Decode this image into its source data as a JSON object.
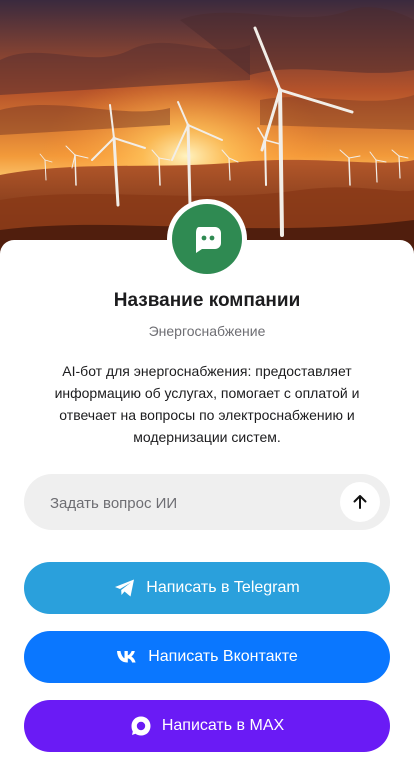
{
  "hero": {
    "image_name": "wind-turbines-sunset"
  },
  "company": {
    "name": "Название компании",
    "category": "Энергоснабжение",
    "description": "AI-бот для энергоснабжения: предоставляет информацию об услугах, помогает с оплатой и отвечает на вопросы по электроснабжению и модернизации систем.",
    "avatar_icon": "chat-bot-icon",
    "avatar_color": "#2f8a52"
  },
  "ask": {
    "placeholder": "Задать вопрос ИИ",
    "value": "",
    "send_icon": "arrow-up-icon"
  },
  "actions": [
    {
      "label": "Написать в Telegram",
      "icon": "telegram-icon",
      "color": "#2aa0dc"
    },
    {
      "label": "Написать Вконтакте",
      "icon": "vk-icon",
      "color": "#0a77ff"
    },
    {
      "label": "Написать в MAX",
      "icon": "max-icon",
      "color": "#6a1bf5"
    }
  ]
}
